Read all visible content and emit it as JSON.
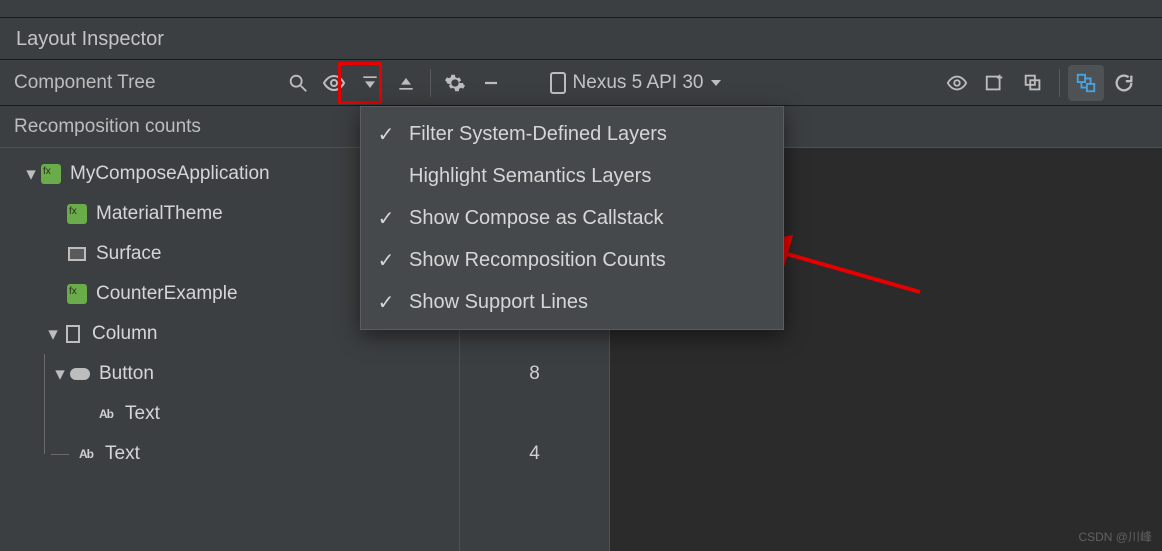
{
  "title": "Layout Inspector",
  "toolbar": {
    "component_tree_label": "Component Tree",
    "device_label": "Nexus 5 API 30"
  },
  "sub_header": "Recomposition counts",
  "tree": {
    "rows": [
      {
        "label": "MyComposeApplication",
        "count": ""
      },
      {
        "label": "MaterialTheme",
        "count": ""
      },
      {
        "label": "Surface",
        "count": ""
      },
      {
        "label": "CounterExample",
        "count": ""
      },
      {
        "label": "Column",
        "count": ""
      },
      {
        "label": "Button",
        "count": "8"
      },
      {
        "label": "Text",
        "count": ""
      },
      {
        "label": "Text",
        "count": "4"
      }
    ]
  },
  "menu": {
    "items": [
      {
        "label": "Filter System-Defined Layers",
        "checked": true
      },
      {
        "label": "Highlight Semantics Layers",
        "checked": false
      },
      {
        "label": "Show Compose as Callstack",
        "checked": true
      },
      {
        "label": "Show Recomposition Counts",
        "checked": true
      },
      {
        "label": "Show Support Lines",
        "checked": true
      }
    ]
  },
  "watermark": "CSDN @川峰"
}
